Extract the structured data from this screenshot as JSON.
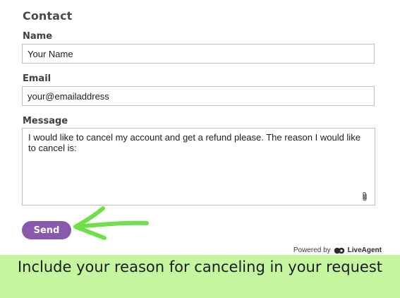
{
  "form": {
    "title": "Contact",
    "name_label": "Name",
    "name_value": "Your Name",
    "email_label": "Email",
    "email_value": "your@emailaddress",
    "message_label": "Message",
    "message_value": "I would like to cancel my account and get a refund please. The reason I would like to cancel is:",
    "send_label": "Send"
  },
  "footer": {
    "powered_by": "Powered by",
    "brand": "LiveAgent"
  },
  "caption": {
    "text": "Include your reason for canceling in your request"
  },
  "icons": {
    "attachment": "paperclip-icon",
    "logo": "liveagent-logo-icon",
    "pointer": "arrow-left-icon"
  },
  "colors": {
    "send_button": "#8a59ae",
    "arrow": "#6fe04a",
    "banner": "#c6f59f"
  }
}
